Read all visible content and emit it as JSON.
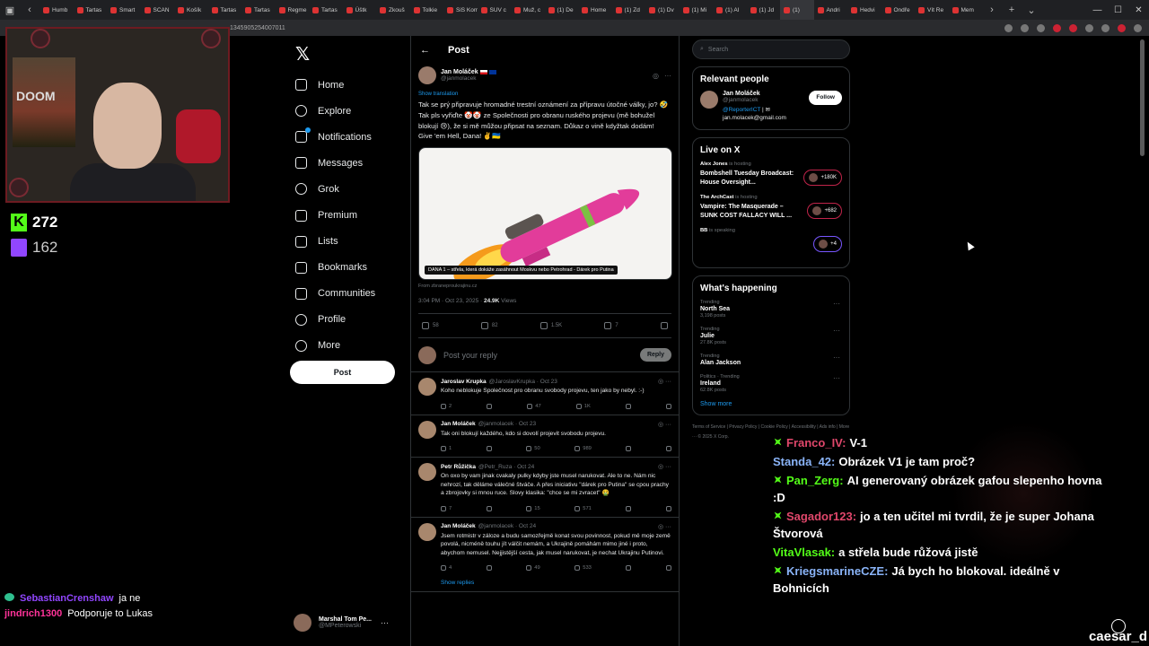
{
  "browser": {
    "tabs": [
      "Humb",
      "Tartas",
      "Smart",
      "SCAN",
      "Košík",
      "Tartas",
      "Tartas",
      "Regme",
      "Tartas",
      "Úštk",
      "Zkouš",
      "Tolkie",
      "SiS Kome",
      "SUV c",
      "Muž, c",
      "(1) De",
      "Home",
      "(1) Zd",
      "(1) Dv",
      "(1) Mi",
      "(1) Al",
      "(1) Jd",
      "(1)",
      "Andri",
      "Hedvi",
      "Ondře",
      "Vít Re",
      "Mem"
    ],
    "url": "1345905254007011"
  },
  "stream": {
    "kick_viewers": "272",
    "twitch_viewers": "162",
    "poster_text": "DOOM",
    "streamer": "caesar_d"
  },
  "xnav": {
    "items": [
      "Home",
      "Explore",
      "Notifications",
      "Messages",
      "Grok",
      "Premium",
      "Lists",
      "Bookmarks",
      "Communities",
      "Profile",
      "More"
    ],
    "post_button": "Post",
    "account_name": "Marshal Tom Pe...",
    "account_handle": "@MPeterowski"
  },
  "post": {
    "header": "Post",
    "author": "Jan Moláček",
    "handle": "@janmolacek",
    "show_translation": "Show translation",
    "text": "Tak se prý připravuje hromadné trestní oznámení za přípravu útočné války, jo? 🤣 Tak pls vyřiďte 🤡🤡 ze Společnosti pro obranu ruského projevu (mě bohužel blokují 😢), že si mě můžou připsat na seznam. Důkaz o vině kdyžtak dodám!\nGive 'em Hell, Dana! ✌️🇺🇦",
    "image_caption": "DANA 1 – střela, která dokáže zasáhnout Moskvu nebo Petrohrad - Dárek pro Putina",
    "from": "From zbraneproukrajinu.cz",
    "time": "3:04 PM · Oct 23, 2025 ·",
    "views": "24.9K",
    "views_label": "Views",
    "replies": "58",
    "reposts": "82",
    "likes": "1.5K",
    "bookmarks": "7",
    "reply_placeholder": "Post your reply",
    "reply_button": "Reply"
  },
  "replies": [
    {
      "name": "Jaroslav Krupka",
      "handle": "@JaroslavKrupka · Oct 23",
      "text": "Koho neblokuje Společnost pro obranu svobody projevu, ten jako by nebyl. :-)",
      "replies": "2",
      "reposts": "",
      "likes": "47",
      "views": "1K"
    },
    {
      "name": "Jan Moláček",
      "handle": "@janmolacek · Oct 23",
      "text": "Tak oni blokují každého, kdo si dovolí projevit svobodu projevu.",
      "replies": "1",
      "reposts": "",
      "likes": "50",
      "views": "989"
    },
    {
      "name": "Petr Růžička",
      "handle": "@Petr_Ruza · Oct 24",
      "text": "On oxo by vam jinak cvakaly pulky kdyby jste musel narukovat. Ale to ne. Nám nic nehrozí, tak děláme válečné štváče. A přes iniciativu \"dárek pro Putina\" se cpou prachy a zbrojovky si mnou ruce. Slovy klasika: \"chce se mi zvracet\" 🤮",
      "replies": "7",
      "reposts": "",
      "likes": "15",
      "views": "571"
    },
    {
      "name": "Jan Moláček",
      "handle": "@janmolacek · Oct 24",
      "text": "Jsem rotmistr v záloze a budu samozřejmě konat svou povinnost, pokud mě moje země povolá, nicméně touhu jít válčit nemám, a Ukrajině pomáhám mimo jiné i proto, abychom nemusel. Nejjistější cesta, jak musel narukovat, je nechat Ukrajinu Putinovi.",
      "replies": "4",
      "reposts": "",
      "likes": "49",
      "views": "533"
    }
  ],
  "show_replies": "Show replies",
  "right": {
    "search_placeholder": "Search",
    "relevant_title": "Relevant people",
    "rp_name": "Jan Moláček",
    "rp_handle": "@janmolacek",
    "rp_bio_link": "@ReporterICT",
    "rp_bio_email": "jan.molacek@gmail.com",
    "follow": "Follow",
    "live_title": "Live on X",
    "live": [
      {
        "host": "Alex Jones",
        "hosting": "is hosting",
        "title": "Bombshell Tuesday Broadcast: House Oversight...",
        "count": "+180K"
      },
      {
        "host": "The ArchCast",
        "hosting": "is hosting",
        "title": "Vampire: The Masquerade – SUNK COST FALLACY WILL ...",
        "count": "+682"
      },
      {
        "host": "BB",
        "hosting": "is speaking",
        "title": "",
        "count": "+4"
      }
    ],
    "happening_title": "What's happening",
    "trends": [
      {
        "cat": "Trending",
        "topic": "North Sea",
        "posts": "3,198 posts"
      },
      {
        "cat": "Trending",
        "topic": "Julie",
        "posts": "27.8K posts"
      },
      {
        "cat": "Trending",
        "topic": "Alan Jackson",
        "posts": ""
      },
      {
        "cat": "Politics · Trending",
        "topic": "Ireland",
        "posts": "62.8K posts"
      }
    ],
    "show_more": "Show more",
    "footer": "Terms of Service  |  Privacy Policy  |  Cookie Policy  |  Accessibility  |  Ads info  |  More ···  © 2025 X Corp."
  },
  "chat": [
    {
      "user": "Franco_IV:",
      "text": "V-1",
      "color": "#e0476b",
      "badge": true
    },
    {
      "user": "Standa_42:",
      "text": "Obrázek V1 je tam proč?",
      "color": "#8ab4f8",
      "badge": false
    },
    {
      "user": "Pan_Zerg:",
      "text": "AI generovaný obrázek gafou slepenho hovna :D",
      "color": "#53fc18",
      "badge": true
    },
    {
      "user": "Sagador123:",
      "text": "jo a ten učitel mi tvrdil, že je super Johana Štvorová",
      "color": "#e0476b",
      "badge": true
    },
    {
      "user": "VitaVlasak:",
      "text": "a střela bude růžová jistě",
      "color": "#53fc18",
      "badge": false
    },
    {
      "user": "KriegsmarineCZE:",
      "text": "Já bych ho blokoval. ideálně v Bohnicích",
      "color": "#8ab4f8",
      "badge": true
    }
  ],
  "chat_small": [
    {
      "user": "SebastianCrenshaw",
      "text": "ja ne"
    },
    {
      "user": "jindrich1300",
      "text": "Podporuje to Lukas"
    }
  ]
}
